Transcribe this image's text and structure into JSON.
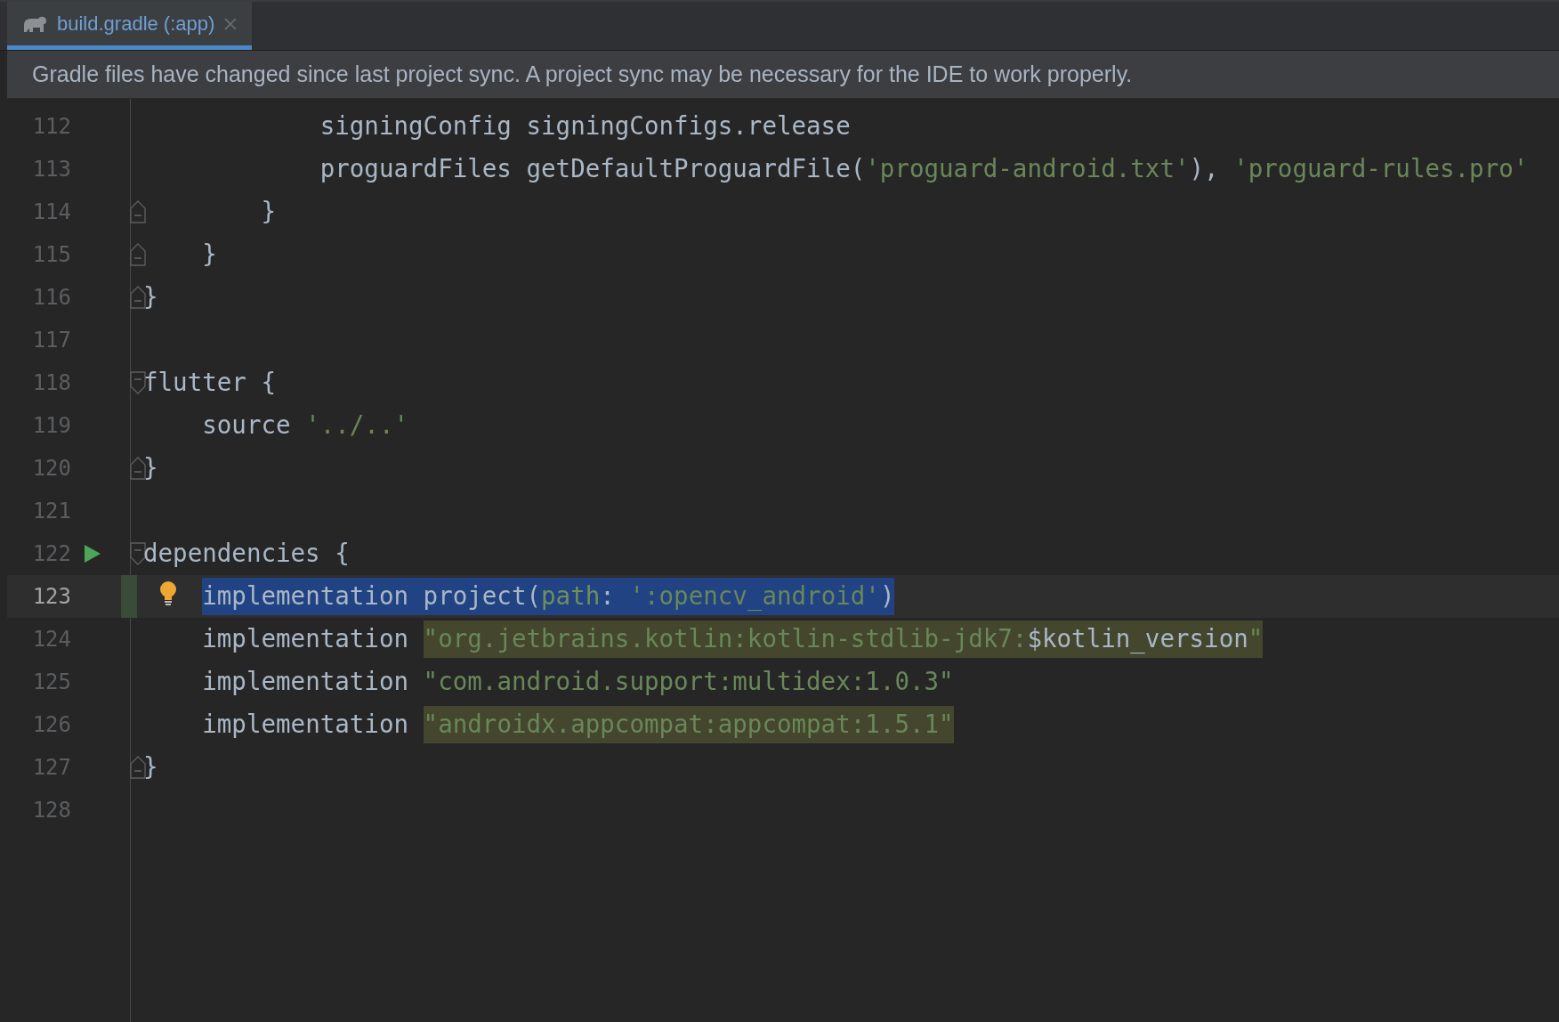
{
  "tabs": [
    {
      "label": "build.gradle (:app)",
      "selected": true
    }
  ],
  "banner": {
    "text": "Gradle files have changed since last project sync. A project sync may be necessary for the IDE to work properly."
  },
  "lines": [
    {
      "number": "112",
      "tokens": [
        {
          "kind": "plain",
          "text": "            signingConfig signingConfigs.release"
        }
      ]
    },
    {
      "number": "113",
      "tokens": [
        {
          "kind": "plain",
          "text": "            proguardFiles getDefaultProguardFile("
        },
        {
          "kind": "string",
          "text": "'proguard-android.txt'"
        },
        {
          "kind": "plain",
          "text": "), "
        },
        {
          "kind": "string",
          "text": "'proguard-rules.pro'"
        }
      ]
    },
    {
      "number": "114",
      "fold_end": true,
      "tokens": [
        {
          "kind": "plain",
          "text": "        }"
        }
      ]
    },
    {
      "number": "115",
      "fold_end": true,
      "tokens": [
        {
          "kind": "plain",
          "text": "    }"
        }
      ]
    },
    {
      "number": "116",
      "fold_end": true,
      "tokens": [
        {
          "kind": "plain",
          "text": "}"
        }
      ]
    },
    {
      "number": "117"
    },
    {
      "number": "118",
      "fold_start": true,
      "tokens": [
        {
          "kind": "plain",
          "text": "flutter {"
        }
      ]
    },
    {
      "number": "119",
      "tokens": [
        {
          "kind": "plain",
          "text": "    source "
        },
        {
          "kind": "string",
          "text": "'../..'"
        }
      ]
    },
    {
      "number": "120",
      "fold_end": true,
      "tokens": [
        {
          "kind": "plain",
          "text": "}"
        }
      ]
    },
    {
      "number": "121"
    },
    {
      "number": "122",
      "fold_start": true,
      "run": true,
      "tokens": [
        {
          "kind": "plain",
          "text": "dependencies {"
        }
      ]
    },
    {
      "number": "123",
      "current": true,
      "changed": true,
      "bulb": true,
      "selected": true,
      "tokens": [
        {
          "kind": "plain",
          "text": "    implementation project("
        },
        {
          "kind": "param",
          "text": "path"
        },
        {
          "kind": "plain",
          "text": ": "
        },
        {
          "kind": "string",
          "text": "':opencv_android'"
        },
        {
          "kind": "plain",
          "text": ")"
        }
      ]
    },
    {
      "number": "124",
      "tokens": [
        {
          "kind": "plain",
          "text": "    implementation "
        },
        {
          "kind": "string",
          "text": "\"org.jetbrains.kotlin:kotlin-stdlib-jdk7:",
          "marked": true
        },
        {
          "kind": "plain",
          "text": "$kotlin_version",
          "marked": true
        },
        {
          "kind": "string",
          "text": "\"",
          "marked": true
        }
      ]
    },
    {
      "number": "125",
      "tokens": [
        {
          "kind": "plain",
          "text": "    implementation "
        },
        {
          "kind": "string",
          "text": "\"com.android.support:multidex:1.0.3\""
        }
      ]
    },
    {
      "number": "126",
      "tokens": [
        {
          "kind": "plain",
          "text": "    implementation "
        },
        {
          "kind": "string",
          "text": "\"androidx.appcompat:appcompat:1.5.1\"",
          "marked": true
        }
      ]
    },
    {
      "number": "127",
      "fold_end": true,
      "tokens": [
        {
          "kind": "plain",
          "text": "}"
        }
      ]
    },
    {
      "number": "128"
    }
  ]
}
